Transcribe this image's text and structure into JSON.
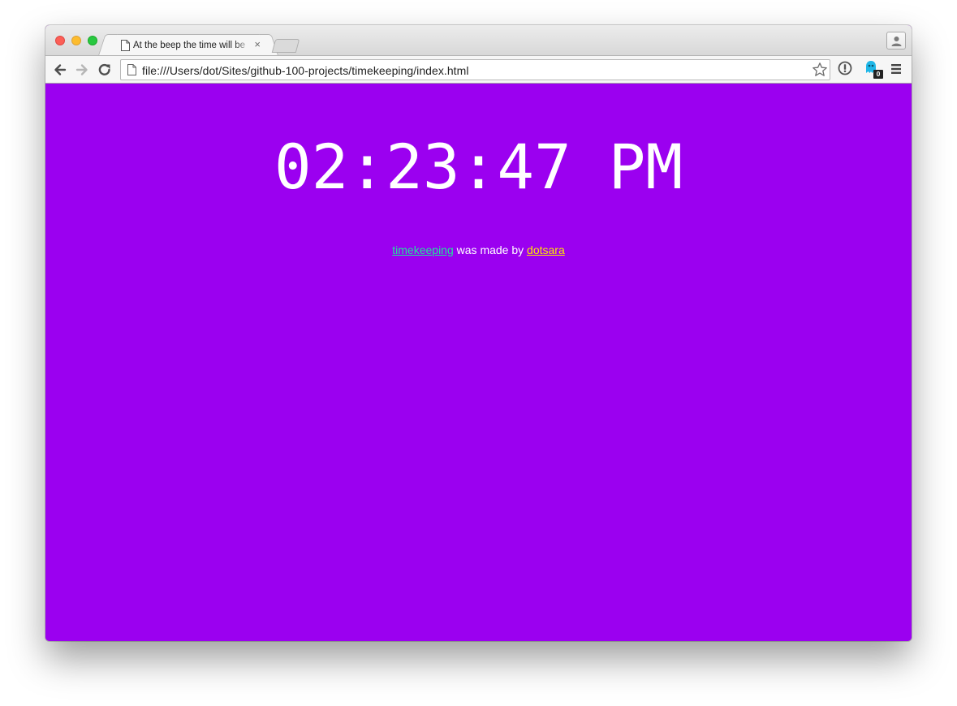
{
  "browser": {
    "tab": {
      "title": "At the beep the time will be",
      "close_glyph": "×",
      "icon": "page-icon"
    },
    "address_bar": {
      "url": "file:///Users/dot/Sites/github-100-projects/timekeeping/index.html"
    },
    "toolbar_icons": [
      "back-icon",
      "forward-icon",
      "reload-icon",
      "star-icon",
      "info-icon",
      "ghost-extension-icon",
      "menu-icon",
      "profile-icon"
    ],
    "extension_badge": "0"
  },
  "page": {
    "background_color": "#9b00f0",
    "clock": {
      "time": "02:23:47 PM"
    },
    "credit": {
      "project_link": "timekeeping",
      "middle_text": " was made by ",
      "author_link": "dotsara",
      "project_link_color": "#20e69a",
      "author_link_color": "#ffe600"
    }
  }
}
